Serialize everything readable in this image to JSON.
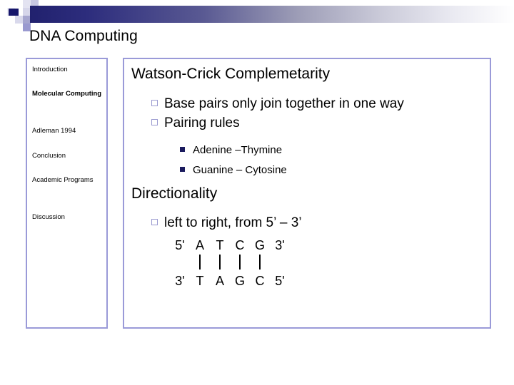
{
  "slide": {
    "title": "DNA Computing"
  },
  "sidebar": {
    "items": [
      {
        "label": "Introduction",
        "active": false
      },
      {
        "label": "Molecular Computing",
        "active": true
      },
      {
        "label": "Adleman 1994",
        "active": false
      },
      {
        "label": "Conclusion",
        "active": false
      },
      {
        "label": "Academic Programs",
        "active": false
      },
      {
        "label": "Discussion",
        "active": false
      }
    ]
  },
  "content": {
    "section1": {
      "heading": "Watson-Crick Complemetarity",
      "bullets": [
        "Base pairs only join together in one way",
        "Pairing rules"
      ],
      "subbullets": [
        "Adenine –Thymine",
        "Guanine – Cytosine"
      ]
    },
    "section2": {
      "heading": "Directionality",
      "bullets": [
        "left to right, from 5’ – 3’"
      ],
      "dna": {
        "top_end_left": "5'",
        "top_bases": [
          "A",
          "T",
          "C",
          "G"
        ],
        "top_end_right": "3'",
        "bonds": [
          "|",
          "|",
          "|",
          "|"
        ],
        "bottom_end_left": "3'",
        "bottom_bases": [
          "T",
          "A",
          "G",
          "C"
        ],
        "bottom_end_right": "5'"
      }
    }
  },
  "colors": {
    "accent_dark": "#21216e",
    "accent_border": "#9a9ad8",
    "bullet_hollow": "#9a9ad0",
    "bullet_solid": "#1b1b5e"
  }
}
